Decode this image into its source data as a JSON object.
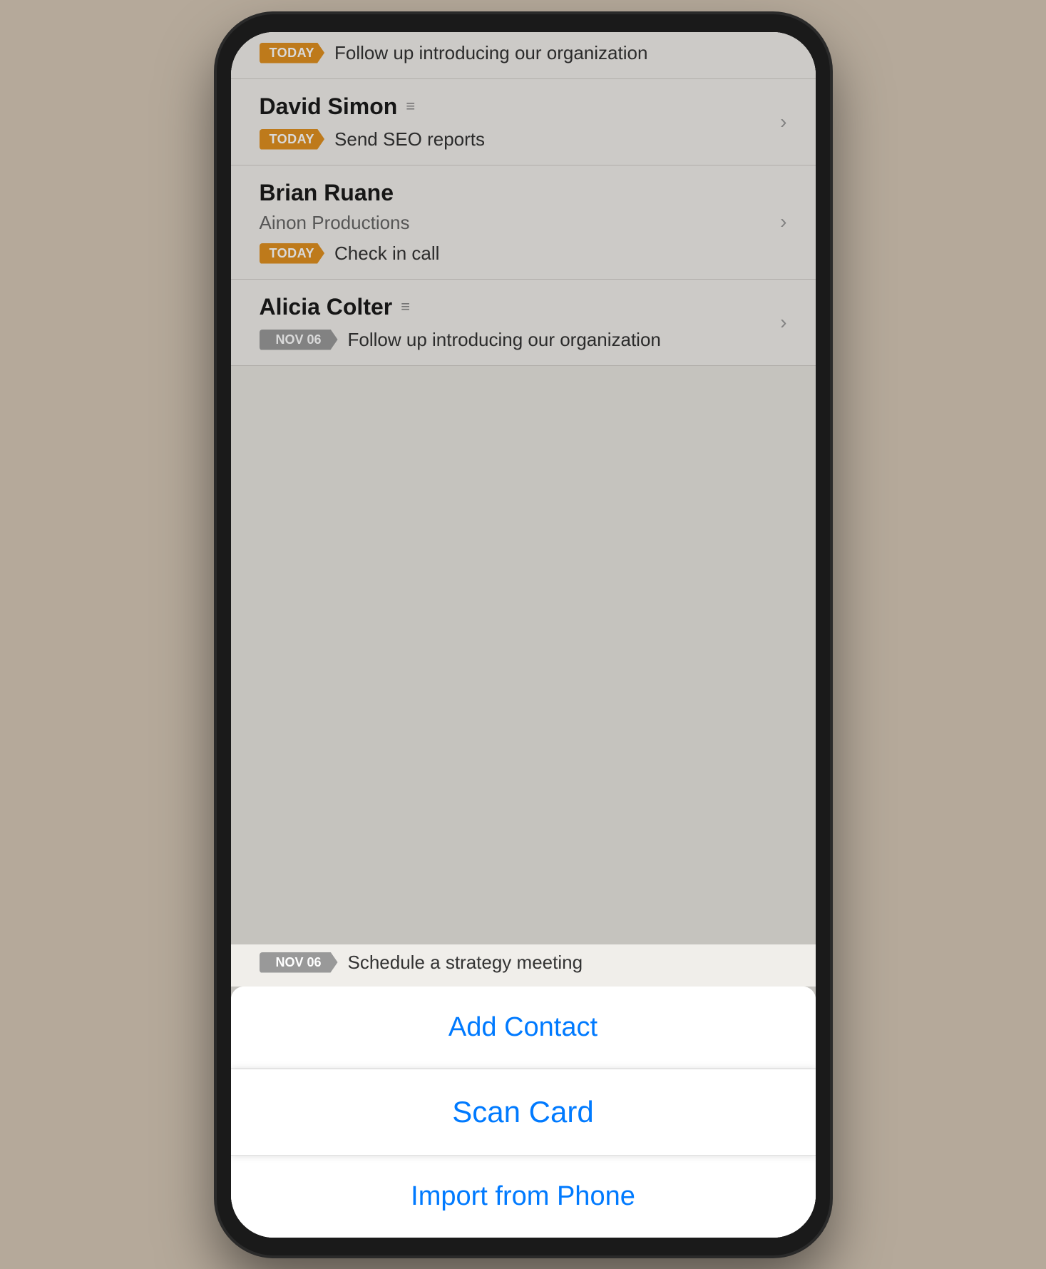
{
  "contacts": [
    {
      "id": "partial-top",
      "task_tag": "TODAY",
      "tag_type": "today",
      "task_text": "Follow up introducing our organization"
    },
    {
      "id": "david-simon",
      "name": "David Simon",
      "has_filter": true,
      "task_tag": "TODAY",
      "tag_type": "today",
      "task_text": "Send SEO reports"
    },
    {
      "id": "brian-ruane",
      "name": "Brian Ruane",
      "company": "Ainon Productions",
      "has_filter": false,
      "task_tag": "TODAY",
      "tag_type": "today",
      "task_text": "Check in call"
    },
    {
      "id": "alicia-colter",
      "name": "Alicia Colter",
      "has_filter": true,
      "task_tag": "NOV 06",
      "tag_type": "date",
      "task_text": "Follow up introducing our organization"
    }
  ],
  "action_sheet": {
    "items": [
      {
        "id": "add-contact",
        "label": "Add Contact"
      },
      {
        "id": "scan-card",
        "label": "Scan Card",
        "active": true
      },
      {
        "id": "import-phone",
        "label": "Import from Phone"
      }
    ]
  },
  "bottom_partial": {
    "tag": "NOV 06",
    "task_text": "Schedule a strategy meeting"
  },
  "colors": {
    "today_orange": "#e09020",
    "date_gray": "#999999",
    "blue_action": "#007AFF"
  }
}
